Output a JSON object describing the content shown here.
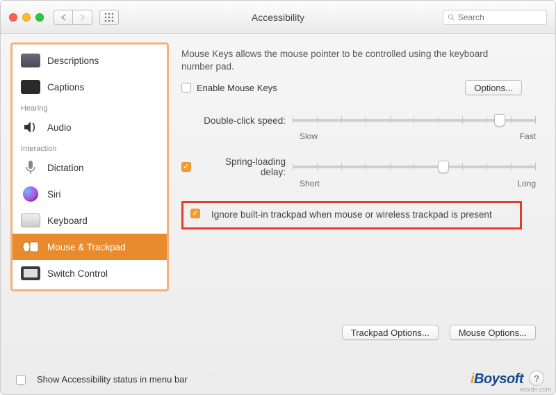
{
  "window": {
    "title": "Accessibility"
  },
  "search": {
    "placeholder": "Search"
  },
  "sidebar": {
    "items": [
      {
        "label": "Descriptions"
      },
      {
        "label": "Captions"
      }
    ],
    "section_hearing": "Hearing",
    "hearing": [
      {
        "label": "Audio"
      }
    ],
    "section_interaction": "Interaction",
    "interaction": [
      {
        "label": "Dictation"
      },
      {
        "label": "Siri"
      },
      {
        "label": "Keyboard"
      },
      {
        "label": "Mouse & Trackpad"
      },
      {
        "label": "Switch Control"
      }
    ]
  },
  "main": {
    "description": "Mouse Keys allows the mouse pointer to be controlled using the keyboard number pad.",
    "enable_label": "Enable Mouse Keys",
    "options_btn": "Options...",
    "slider1": {
      "label": "Double-click speed:",
      "min": "Slow",
      "max": "Fast",
      "value_pct": 85
    },
    "slider2": {
      "label": "Spring-loading delay:",
      "min": "Short",
      "max": "Long",
      "value_pct": 62,
      "checked": true
    },
    "ignore_trackpad": {
      "label": "Ignore built-in trackpad when mouse or wireless trackpad is present",
      "checked": true
    },
    "trackpad_options_btn": "Trackpad Options...",
    "mouse_options_btn": "Mouse Options..."
  },
  "footer": {
    "show_status_label": "Show Accessibility status in menu bar",
    "brand": "iBoysoft",
    "source": "wsxdn.com"
  }
}
